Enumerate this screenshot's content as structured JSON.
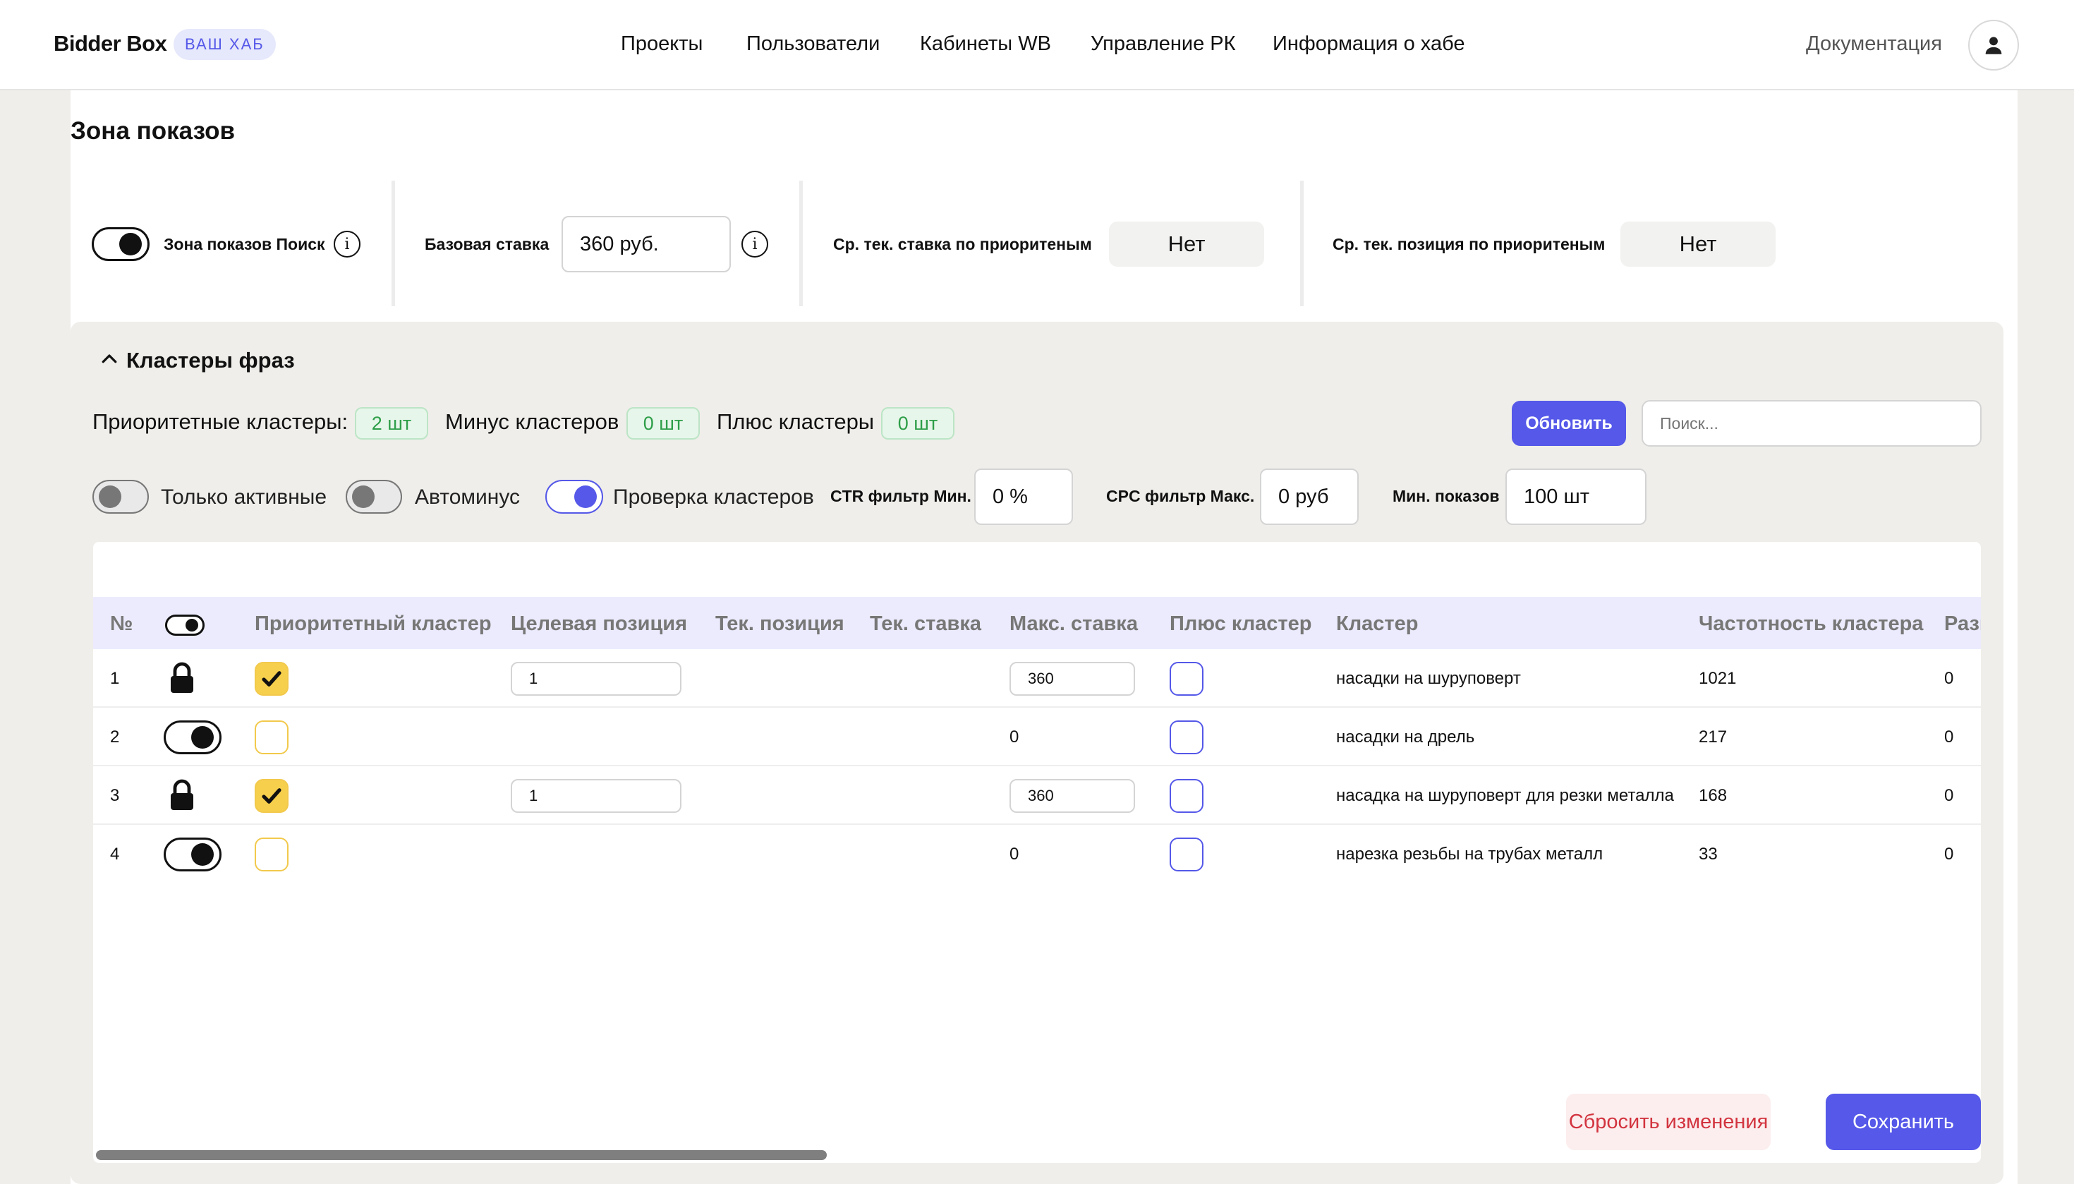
{
  "header": {
    "brand": "Bidder Box",
    "hub_badge": "ВАШ ХАБ",
    "nav": [
      "Проекты",
      "Пользователи",
      "Кабинеты WB",
      "Управление РК",
      "Информация о хабе"
    ],
    "docs": "Документация",
    "avatar_icon": "user-icon"
  },
  "zone": {
    "title": "Зона показов",
    "search_zone_label": "Зона показов Поиск",
    "search_zone_on": true,
    "base_bid_label": "Базовая ставка",
    "base_bid_value": "360 руб.",
    "avg_bid_label": "Ср. тек. ставка по приоритеным",
    "avg_bid_value": "Нет",
    "avg_pos_label": "Ср. тек. позиция по приоритеным",
    "avg_pos_value": "Нет"
  },
  "clusters": {
    "section_title": "Кластеры фраз",
    "priority_label": "Приоритетные кластеры:",
    "priority_count": "2 шт",
    "minus_label": "Минус кластеров",
    "minus_count": "0 шт",
    "plus_label": "Плюс кластеры",
    "plus_count": "0 шт",
    "refresh_button": "Обновить",
    "search_placeholder": "Поиск...",
    "filters": {
      "only_active_label": "Только активные",
      "only_active_on": false,
      "autominus_label": "Автоминус",
      "autominus_on": false,
      "check_clusters_label": "Проверка кластеров",
      "check_clusters_on": true,
      "ctr_label": "CTR фильтр Мин.",
      "ctr_value": "0 %",
      "cpc_label": "CPC фильтр Макс.",
      "cpc_value": "0 руб",
      "min_impr_label": "Мин. показов",
      "min_impr_value": "100 шт"
    }
  },
  "table": {
    "columns": [
      "№",
      "Приоритетный кластер",
      "Целевая позиция",
      "Тек. позиция",
      "Тек. ставка",
      "Макс. ставка",
      "Плюс кластер",
      "Кластер",
      "Частотность кластера",
      "Разн"
    ],
    "rows": [
      {
        "num": "1",
        "state": "locked",
        "priority": true,
        "target": "1",
        "max_bid": "360",
        "max_bid_editable": true,
        "plus": false,
        "cluster": "насадки на шуруповерт",
        "freq": "1021",
        "diff": "0"
      },
      {
        "num": "2",
        "state": "toggle-on",
        "priority": false,
        "target": "",
        "max_bid": "0",
        "max_bid_editable": false,
        "plus": false,
        "cluster": "насадки на дрель",
        "freq": "217",
        "diff": "0"
      },
      {
        "num": "3",
        "state": "locked",
        "priority": true,
        "target": "1",
        "max_bid": "360",
        "max_bid_editable": true,
        "plus": false,
        "cluster": "насадка на шуруповерт для резки металла",
        "freq": "168",
        "diff": "0"
      },
      {
        "num": "4",
        "state": "toggle-on",
        "priority": false,
        "target": "",
        "max_bid": "0",
        "max_bid_editable": false,
        "plus": false,
        "cluster": "нарезка резьбы на трубах металл",
        "freq": "33",
        "diff": "0"
      }
    ]
  },
  "actions": {
    "reset": "Сбросить изменения",
    "save": "Сохранить"
  },
  "colors": {
    "accent": "#5558E8",
    "priority_yellow": "#F6D04D",
    "pill_green": "#2E9E49",
    "reset_red": "#D2343F"
  }
}
